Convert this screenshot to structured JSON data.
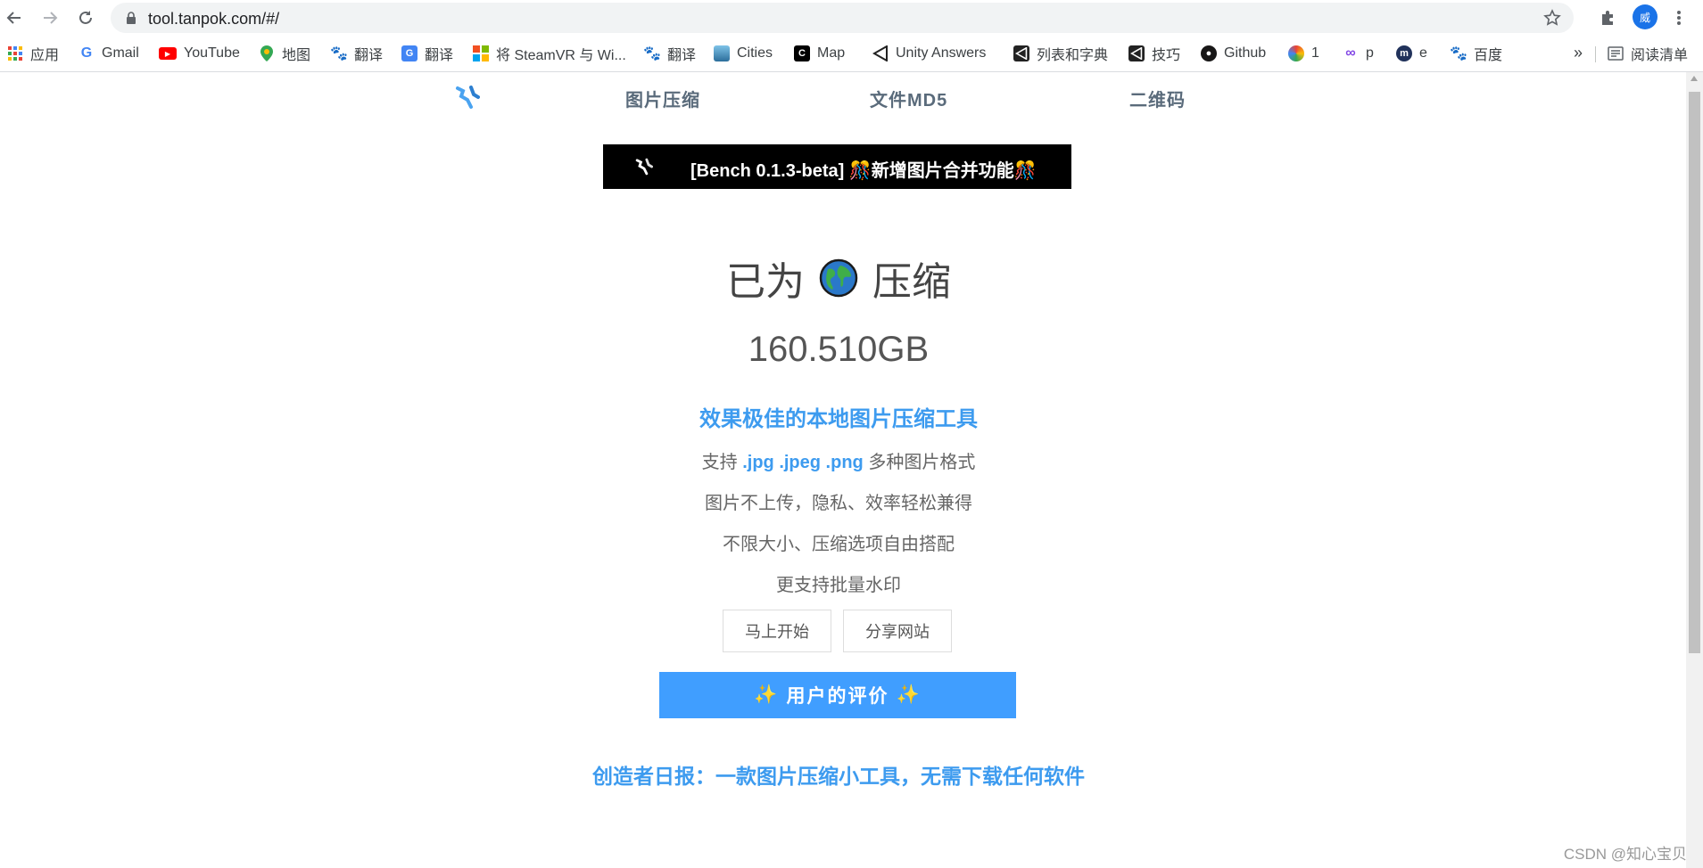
{
  "browser": {
    "url": "tool.tanpok.com/#/",
    "profile_initial": "威"
  },
  "bookmarks": [
    {
      "label": "应用",
      "icon": "apps-grid-icon"
    },
    {
      "label": "Gmail",
      "icon": "google-icon"
    },
    {
      "label": "YouTube",
      "icon": "youtube-icon"
    },
    {
      "label": "地图",
      "icon": "maps-pin-icon"
    },
    {
      "label": "翻译",
      "icon": "baidu-paw-icon"
    },
    {
      "label": "翻译",
      "icon": "google-translate-icon"
    },
    {
      "label": "将 SteamVR 与 Wi...",
      "icon": "windows-icon"
    },
    {
      "label": "翻译",
      "icon": "baidu-paw-icon"
    },
    {
      "label": "Cities",
      "icon": "cities-icon"
    },
    {
      "label": "Map",
      "icon": "c-logo-icon"
    },
    {
      "label": "Unity Answers",
      "icon": "unity-icon"
    },
    {
      "label": "列表和字典",
      "icon": "unity-icon"
    },
    {
      "label": "技巧",
      "icon": "unity-icon"
    },
    {
      "label": "Github",
      "icon": "github-icon"
    },
    {
      "label": "1",
      "icon": "colorful-icon"
    },
    {
      "label": "p",
      "icon": "chain-icon"
    },
    {
      "label": "e",
      "icon": "e-logo-icon"
    },
    {
      "label": "百度",
      "icon": "baidu-paw-icon"
    }
  ],
  "bookmarks_more": "»",
  "reading_list": "阅读清单",
  "nav": {
    "items": [
      "图片压缩",
      "文件MD5",
      "二维码"
    ]
  },
  "banner": {
    "text": "[Bench 0.1.3-beta] 🎊新增图片合并功能🎊"
  },
  "hero": {
    "prefix": "已为",
    "suffix": "压缩",
    "size": "160.510GB",
    "tagline": "效果极佳的本地图片压缩工具",
    "support_prefix": "支持",
    "formats": ".jpg .jpeg .png",
    "support_suffix": "多种图片格式",
    "feature1": "图片不上传，隐私、效率轻松兼得",
    "feature2": "不限大小、压缩选项自由搭配",
    "feature3": "更支持批量水印"
  },
  "buttons": {
    "start": "马上开始",
    "share": "分享网站",
    "reviews": "用户的评价"
  },
  "daily": "创造者日报：一款图片压缩小工具，无需下载任何软件",
  "watermark": "CSDN @知心宝贝",
  "colors": {
    "accent": "#409eff",
    "link_blue": "#3d9bef",
    "nav_text": "#5a6b7b",
    "banner_bg": "#000000"
  }
}
